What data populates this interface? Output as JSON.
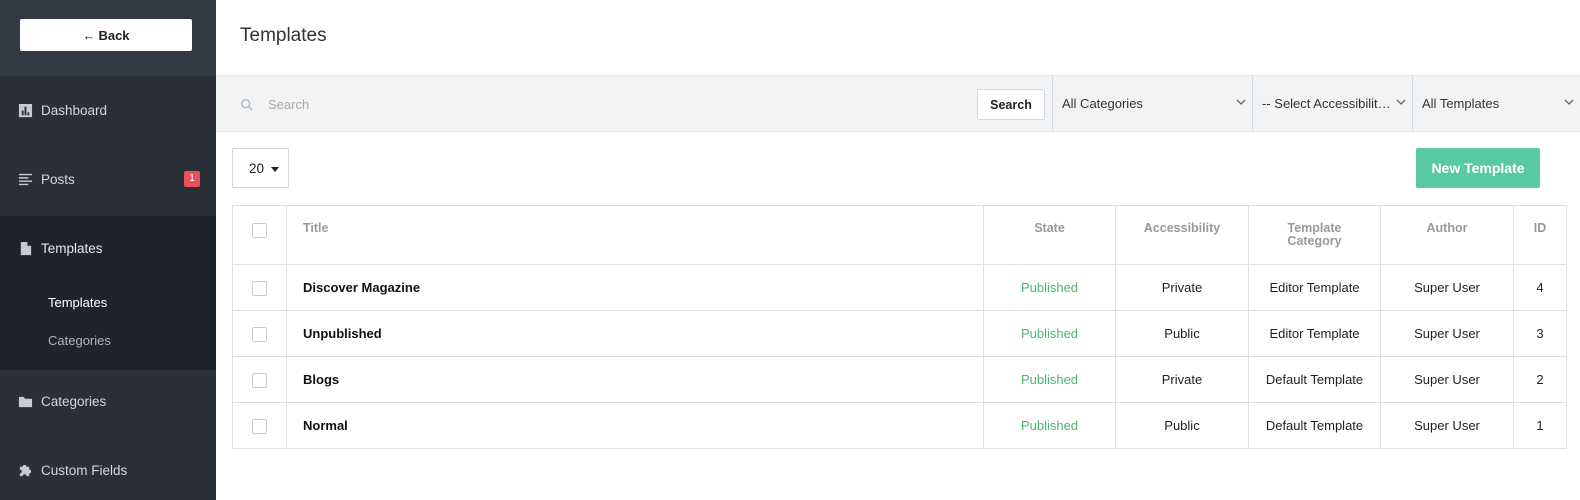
{
  "sidebar": {
    "back_label": "Back",
    "items": [
      {
        "label": "Dashboard",
        "icon": "chart-icon"
      },
      {
        "label": "Posts",
        "icon": "list-icon",
        "badge": "1"
      },
      {
        "label": "Templates",
        "icon": "file-icon"
      },
      {
        "label": "Categories",
        "icon": "folder-icon"
      },
      {
        "label": "Custom Fields",
        "icon": "puzzle-icon"
      }
    ],
    "sub_items": [
      {
        "label": "Templates",
        "active": true
      },
      {
        "label": "Categories",
        "active": false
      }
    ]
  },
  "header": {
    "title": "Templates"
  },
  "filters": {
    "search_placeholder": "Search",
    "search_value": "",
    "search_button": "Search",
    "category_select": "All Categories",
    "accessibility_select": "-- Select Accessibility --",
    "templates_select": "All Templates"
  },
  "toolbar": {
    "per_page": "20",
    "new_button": "New Template"
  },
  "table": {
    "columns": {
      "title": "Title",
      "state": "State",
      "accessibility": "Accessibility",
      "category": "Template Category",
      "author": "Author",
      "id": "ID"
    },
    "rows": [
      {
        "title": "Discover Magazine",
        "state": "Published",
        "accessibility": "Private",
        "category": "Editor Template",
        "author": "Super User",
        "id": "4"
      },
      {
        "title": "Unpublished",
        "state": "Published",
        "accessibility": "Public",
        "category": "Editor Template",
        "author": "Super User",
        "id": "3"
      },
      {
        "title": "Blogs",
        "state": "Published",
        "accessibility": "Private",
        "category": "Default Template",
        "author": "Super User",
        "id": "2"
      },
      {
        "title": "Normal",
        "state": "Published",
        "accessibility": "Public",
        "category": "Default Template",
        "author": "Super User",
        "id": "1"
      }
    ]
  },
  "colors": {
    "sidebar_bg": "#2b3038",
    "accent": "#58c9a4",
    "published": "#4cb86b",
    "badge": "#e9505a"
  }
}
